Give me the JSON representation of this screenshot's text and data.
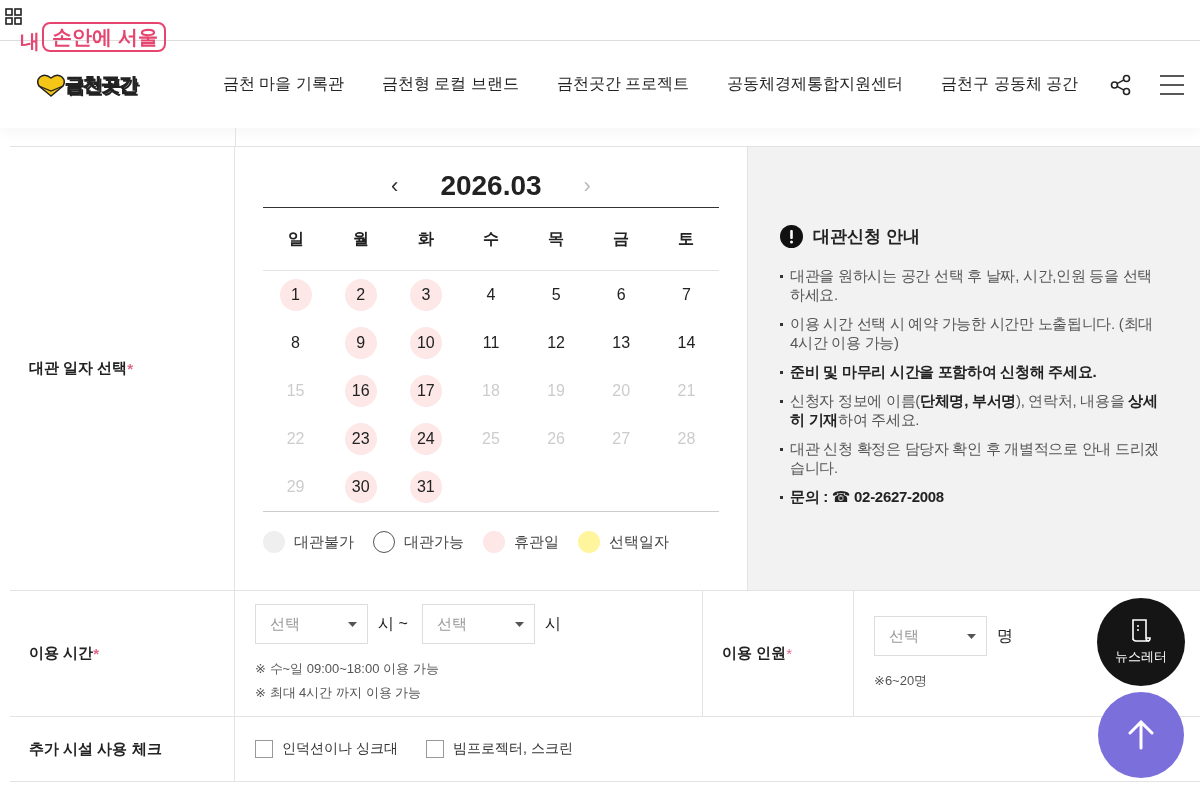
{
  "top_bar": {
    "seoul_badge": {
      "prefix": "내",
      "boxed": "손안에 서울"
    }
  },
  "header": {
    "logo": "금천곳간",
    "nav": [
      "금천 마을 기록관",
      "금천형 로컬 브랜드",
      "금천곳간 프로젝트",
      "공동체경제통합지원센터",
      "금천구 공동체 공간"
    ]
  },
  "form": {
    "date_row": {
      "label": "대관 일자 선택",
      "required_mark": "*",
      "calendar": {
        "prev": {
          "text": "‹",
          "disabled": false
        },
        "month": "2026.03",
        "next": {
          "text": "›",
          "disabled": true
        },
        "weekdays": [
          "일",
          "월",
          "화",
          "수",
          "목",
          "금",
          "토"
        ],
        "weeks": [
          [
            {
              "day": "1",
              "kind": "holiday"
            },
            {
              "day": "2",
              "kind": "holiday"
            },
            {
              "day": "3",
              "kind": "holiday"
            },
            {
              "day": "4",
              "kind": "available"
            },
            {
              "day": "5",
              "kind": "available"
            },
            {
              "day": "6",
              "kind": "available"
            },
            {
              "day": "7",
              "kind": "available"
            }
          ],
          [
            {
              "day": "8",
              "kind": "available"
            },
            {
              "day": "9",
              "kind": "holiday"
            },
            {
              "day": "10",
              "kind": "holiday"
            },
            {
              "day": "11",
              "kind": "available"
            },
            {
              "day": "12",
              "kind": "available"
            },
            {
              "day": "13",
              "kind": "available"
            },
            {
              "day": "14",
              "kind": "available"
            }
          ],
          [
            {
              "day": "15",
              "kind": "unavailable"
            },
            {
              "day": "16",
              "kind": "holiday"
            },
            {
              "day": "17",
              "kind": "holiday"
            },
            {
              "day": "18",
              "kind": "unavailable"
            },
            {
              "day": "19",
              "kind": "unavailable"
            },
            {
              "day": "20",
              "kind": "unavailable"
            },
            {
              "day": "21",
              "kind": "unavailable"
            }
          ],
          [
            {
              "day": "22",
              "kind": "unavailable"
            },
            {
              "day": "23",
              "kind": "holiday"
            },
            {
              "day": "24",
              "kind": "holiday"
            },
            {
              "day": "25",
              "kind": "unavailable"
            },
            {
              "day": "26",
              "kind": "unavailable"
            },
            {
              "day": "27",
              "kind": "unavailable"
            },
            {
              "day": "28",
              "kind": "unavailable"
            }
          ],
          [
            {
              "day": "29",
              "kind": "unavailable"
            },
            {
              "day": "30",
              "kind": "holiday"
            },
            {
              "day": "31",
              "kind": "holiday"
            }
          ]
        ],
        "legend": [
          {
            "label": "대관불가",
            "kind": "unavailable"
          },
          {
            "label": "대관가능",
            "kind": "available"
          },
          {
            "label": "휴관일",
            "kind": "holiday"
          },
          {
            "label": "선택일자",
            "kind": "selected"
          }
        ]
      },
      "guide": {
        "title": "대관신청 안내",
        "items": [
          {
            "text": "대관을 원하시는 공간 선택 후 날짜, 시간,인원 등을 선택하세요."
          },
          {
            "text": "이용 시간 선택 시 예약 가능한 시간만 노출됩니다. (최대 4시간 이용 가능)"
          },
          {
            "text": "**준비 및 마무리 시간을 포함하여 신청해 주세요.**"
          },
          {
            "text": "신청자 정보에 이름(**단체명, 부서명**), 연락처, 내용을 **상세히 기재**하여 주세요."
          },
          {
            "text": "대관 신청 확정은 담당자 확인 후 개별적으로 안내 드리겠습니다."
          },
          {
            "text": "**문의 : ☎ 02-2627-2008**"
          }
        ]
      }
    },
    "time_row": {
      "label": "이용 시간",
      "required_mark": "*",
      "start": {
        "placeholder": "선택"
      },
      "start_unit": "시 ~",
      "end": {
        "placeholder": "선택"
      },
      "end_unit": "시",
      "notes": [
        "※ 수~일 09:00~18:00 이용 가능",
        "※ 최대 4시간 까지 이용 가능"
      ]
    },
    "people_row": {
      "label": "이용 인원",
      "required_mark": "*",
      "select": {
        "placeholder": "선택"
      },
      "unit": "명",
      "note": "※6~20명"
    },
    "facility_row": {
      "label": "추가 시설 사용 체크",
      "options": [
        {
          "label": "인덕션이나 싱크대",
          "checked": false
        },
        {
          "label": "빔프로젝터, 스크린",
          "checked": false
        }
      ]
    }
  },
  "floating": {
    "newsletter": "뉴스레터"
  }
}
